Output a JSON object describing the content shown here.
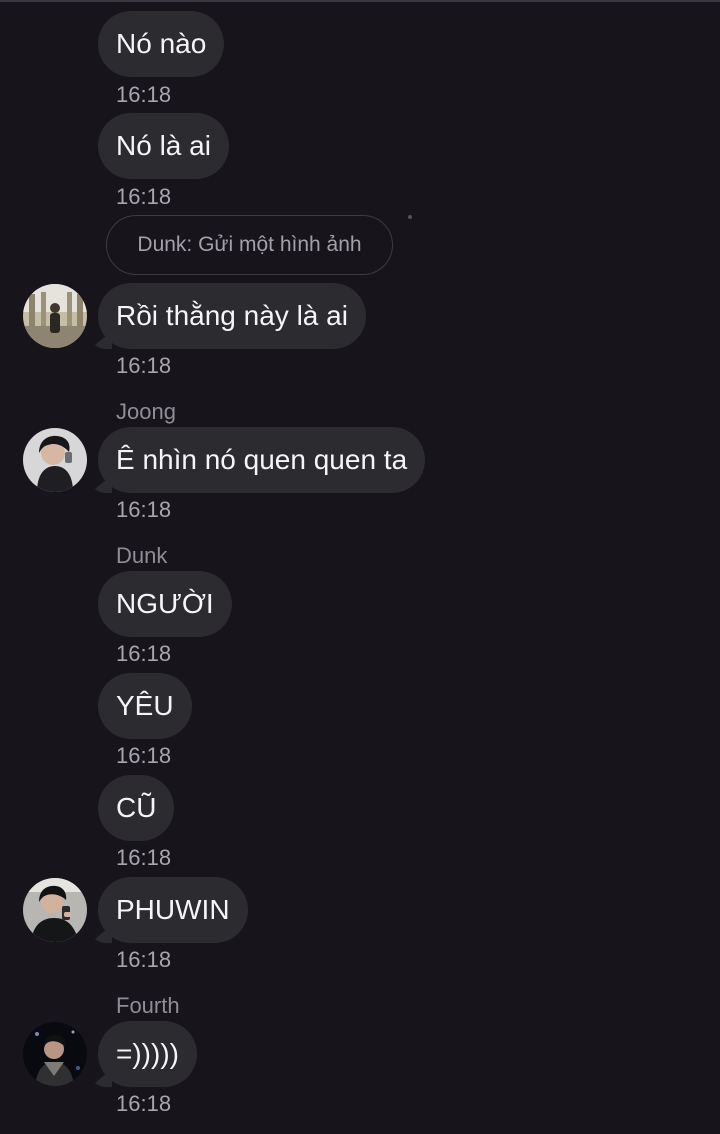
{
  "messages": [
    {
      "text": "Nó nào",
      "time": "16:18"
    },
    {
      "text": "Nó là ai",
      "time": "16:18"
    },
    {
      "text": "Rồi thằng này là ai",
      "time": "16:18"
    },
    {
      "sender": "Joong",
      "text": "Ê nhìn nó quen quen ta",
      "time": "16:18"
    },
    {
      "sender": "Dunk",
      "text": "NGƯỜI",
      "time": "16:18"
    },
    {
      "text": "YÊU",
      "time": "16:18"
    },
    {
      "text": "CŨ",
      "time": "16:18"
    },
    {
      "text": "PHUWIN",
      "time": "16:18"
    },
    {
      "sender": "Fourth",
      "text": "=)))))",
      "time": "16:18"
    }
  ],
  "system_notice": "Dunk: Gửi một hình ảnh",
  "avatars": [
    "avatar-photo-icon",
    "avatar-photo-icon",
    "avatar-photo-icon",
    "avatar-photo-icon"
  ],
  "colors": {
    "background": "#17141c",
    "bubble": "#2c2b2f",
    "text": "#f5f5f7",
    "time": "#a7a6ad",
    "sender": "#8f8e95"
  }
}
